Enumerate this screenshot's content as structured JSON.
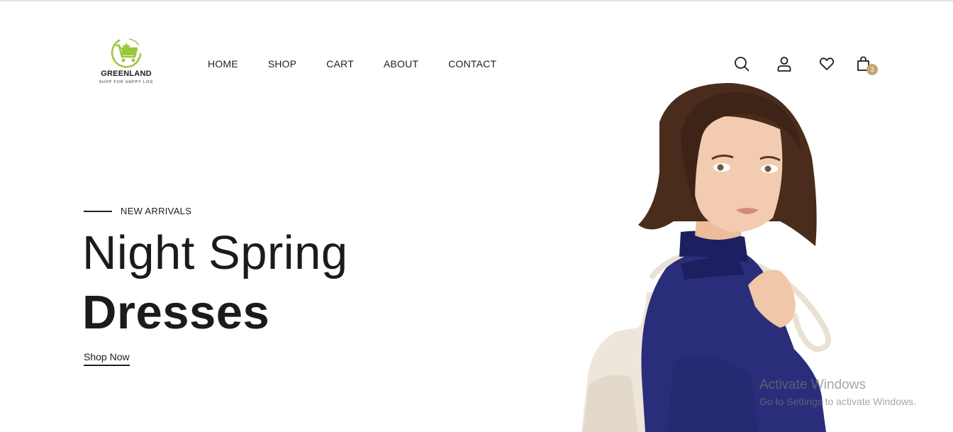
{
  "brand": {
    "name": "GREENLAND",
    "tagline": "SHOP FOR HAPPY LIFE",
    "logo_color": "#9cc63b"
  },
  "nav": {
    "items": [
      "HOME",
      "SHOP",
      "CART",
      "ABOUT",
      "CONTACT"
    ]
  },
  "header_icons": {
    "search": "search-icon",
    "account": "user-icon",
    "wishlist": "heart-icon",
    "cart": "shopping-bag-icon",
    "cart_count": "3",
    "badge_color": "#c4a472"
  },
  "hero": {
    "eyebrow": "NEW ARRIVALS",
    "title_line1": "Night Spring",
    "title_line2": "Dresses",
    "cta_label": "Shop Now",
    "image": "woman-in-navy-blouse-with-cream-backpack"
  },
  "watermark": {
    "title": "Activate Windows",
    "subtitle": "Go to Settings to activate Windows."
  }
}
